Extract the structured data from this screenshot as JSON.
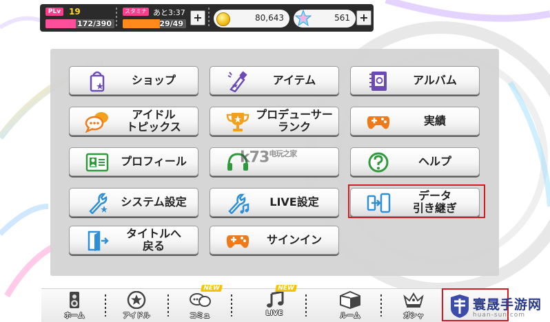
{
  "status": {
    "plv_badge": "PLv",
    "level": "19",
    "exp_text": "172/390",
    "exp_fraction": 0.44,
    "stamina_badge": "スタミナ",
    "stamina_time": "あと3:37",
    "stamina_text": "29/49",
    "stamina_fraction": 0.59,
    "coins": "80,643",
    "jewels": "561",
    "plus_label": "+"
  },
  "menu": {
    "shop": "ショップ",
    "item": "アイテム",
    "album": "アルバム",
    "idol_topics": "アイドル\nトピックス",
    "producer_rank": "プロデューサー\nランク",
    "achievements": "実績",
    "profile": "プロフィール",
    "help": "ヘルプ",
    "system_settings": "システム設定",
    "live_settings": "LIVE設定",
    "data_transfer": "データ\n引き継ぎ",
    "back_to_title": "タイトルへ\n戻る",
    "sign_in": "サインイン"
  },
  "watermark": "k73",
  "watermark_sub": "电玩之家",
  "nav": {
    "home": "ホーム",
    "idol": "アイドル",
    "commu": "コミュ",
    "live": "LIVE",
    "room": "ルーム",
    "gacha": "ガシャ",
    "new_badge": "NEW"
  },
  "brand": {
    "title": "寰晟手游网",
    "sub": "huan-sun.com"
  },
  "colors": {
    "exp_bar": "#ff4f9a",
    "stamina_bar": "#ff8a1c",
    "highlight": "#d71920",
    "accent_purple": "#6a4bb5",
    "accent_orange": "#f07a1a",
    "accent_green": "#2f9a3c"
  }
}
